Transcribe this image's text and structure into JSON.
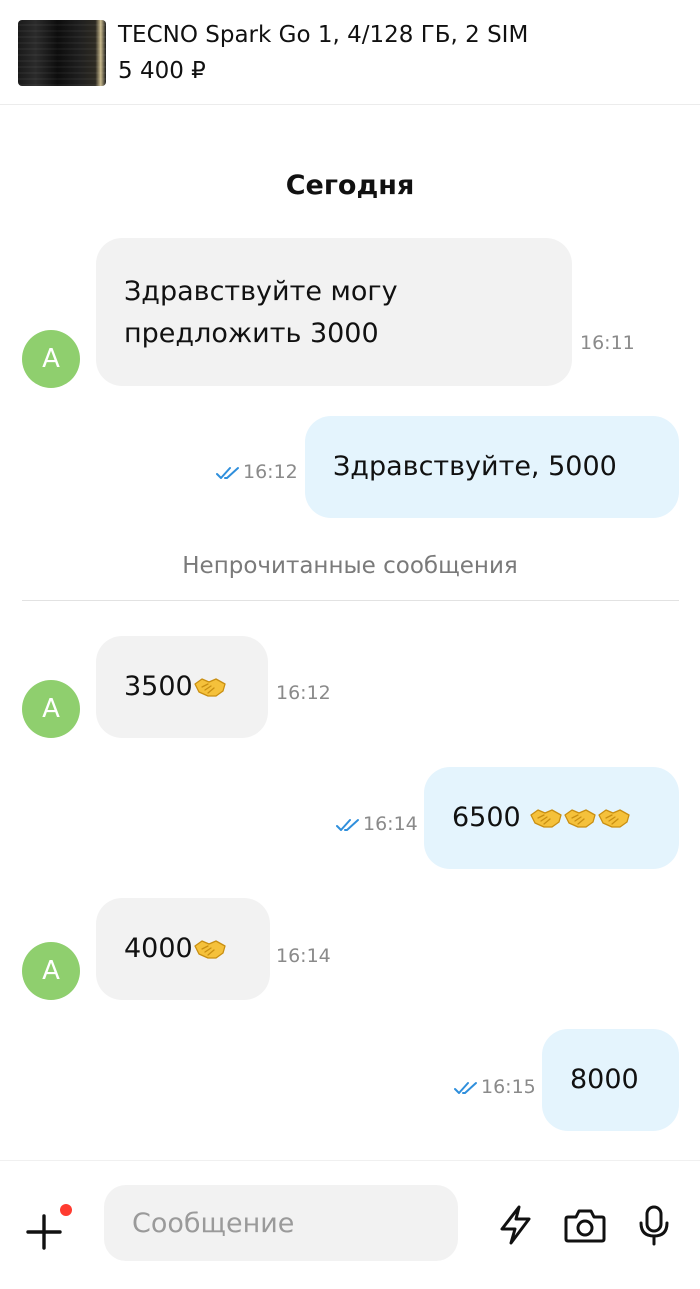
{
  "listing": {
    "title": "TECNO Spark Go 1, 4/128 ГБ, 2 SIM",
    "price": "5 400 ₽"
  },
  "chat": {
    "day_label": "Сегодня",
    "unread_label": "Непрочитанные сообщения",
    "avatar_initial": "A",
    "messages": [
      {
        "direction": "incoming",
        "line1": "Здравствуйте могу",
        "line2": "предложить 3000",
        "time": "16:11"
      },
      {
        "direction": "outgoing",
        "text": "Здравствуйте,  5000",
        "time": "16:12",
        "status": "read"
      },
      {
        "direction": "incoming",
        "text": "3500",
        "emoji": "handshake",
        "time": "16:12"
      },
      {
        "direction": "outgoing",
        "text": "6500 ",
        "emoji": "handshake x3",
        "time": "16:14",
        "status": "read"
      },
      {
        "direction": "incoming",
        "text": "4000",
        "emoji": "handshake",
        "time": "16:14"
      },
      {
        "direction": "outgoing",
        "text": "8000",
        "time": "16:15",
        "status": "read"
      }
    ]
  },
  "composer": {
    "placeholder": "Сообщение",
    "icons": [
      "plus-icon",
      "lightning-icon",
      "camera-icon",
      "microphone-icon"
    ]
  },
  "colors": {
    "incoming_bubble": "#f2f2f2",
    "outgoing_bubble": "#e4f4fd",
    "avatar": "#8fcf6e",
    "read_check": "#2f8fdc",
    "notification_dot": "#ff3b30"
  }
}
